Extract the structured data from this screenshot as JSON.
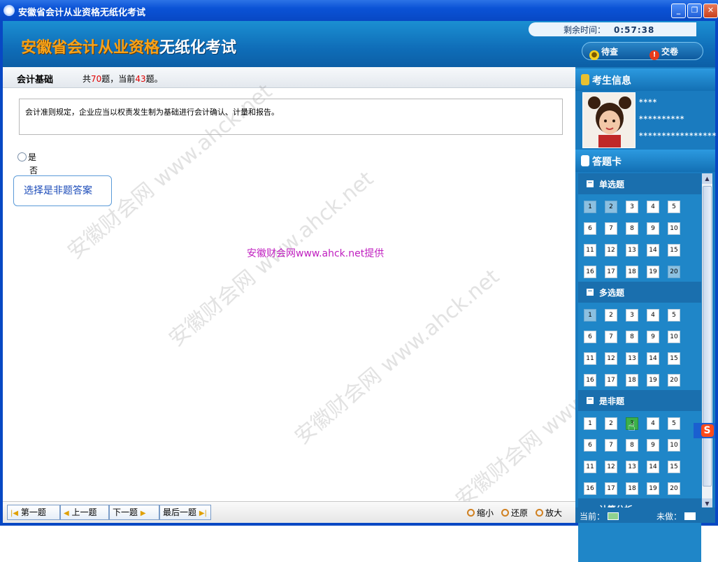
{
  "window": {
    "title": "安徽省会计从业资格无纸化考试"
  },
  "header": {
    "logo_part1": "安徽省会计从业资格",
    "logo_part2": "无纸化考试",
    "timer_label": "剩余时间：",
    "timer_value": "0:57:38",
    "pending_label": "待查",
    "submit_label": "交卷"
  },
  "infobar": {
    "subject": "会计基础",
    "count_pre": "共",
    "total": "70",
    "count_mid": "题，当前",
    "current": "43",
    "count_post": "题。"
  },
  "question": {
    "text": "会计准则规定，企业应当以权责发生制为基础进行会计确认、计量和报告。",
    "option_yes": "是",
    "option_no": "否",
    "tooltip": "选择是非题答案"
  },
  "watermark": {
    "text": "安徽财会网 www.ahck.net",
    "center_text": "安徽财会网www.ahck.net提供"
  },
  "nav": {
    "first": "第一题",
    "prev": "上一题",
    "next": "下一题",
    "last": "最后一题",
    "zoom_out": "缩小",
    "restore": "还原",
    "zoom_in": "放大"
  },
  "sidebar": {
    "examinee_title": "考生信息",
    "answer_card_title": "答题卡",
    "masked_name": "∗∗∗∗",
    "masked_id": "∗∗∗∗∗∗∗∗∗∗",
    "masked_no": "∗∗∗∗∗∗∗∗∗∗∗∗∗∗∗∗∗"
  },
  "answer_card": {
    "sections": [
      {
        "title": "单选题",
        "numbers": [
          "1",
          "2",
          "3",
          "4",
          "5",
          "6",
          "7",
          "8",
          "9",
          "10",
          "11",
          "12",
          "13",
          "14",
          "15",
          "16",
          "17",
          "18",
          "19",
          "20"
        ],
        "done": [
          "1",
          "2",
          "20"
        ],
        "current": ""
      },
      {
        "title": "多选题",
        "numbers": [
          "1",
          "2",
          "3",
          "4",
          "5",
          "6",
          "7",
          "8",
          "9",
          "10",
          "11",
          "12",
          "13",
          "14",
          "15",
          "16",
          "17",
          "18",
          "19",
          "20"
        ],
        "done": [
          "1"
        ],
        "current": ""
      },
      {
        "title": "是非题",
        "numbers": [
          "1",
          "2",
          "3",
          "4",
          "5",
          "6",
          "7",
          "8",
          "9",
          "10",
          "11",
          "12",
          "13",
          "14",
          "15",
          "16",
          "17",
          "18",
          "19",
          "20"
        ],
        "done": [],
        "current": "3"
      }
    ],
    "next_section_partial": "计算分析"
  },
  "legend": {
    "current": "当前：",
    "undone": "未做：",
    "current_color": "#8fd18f",
    "undone_color": "#ffffff"
  }
}
